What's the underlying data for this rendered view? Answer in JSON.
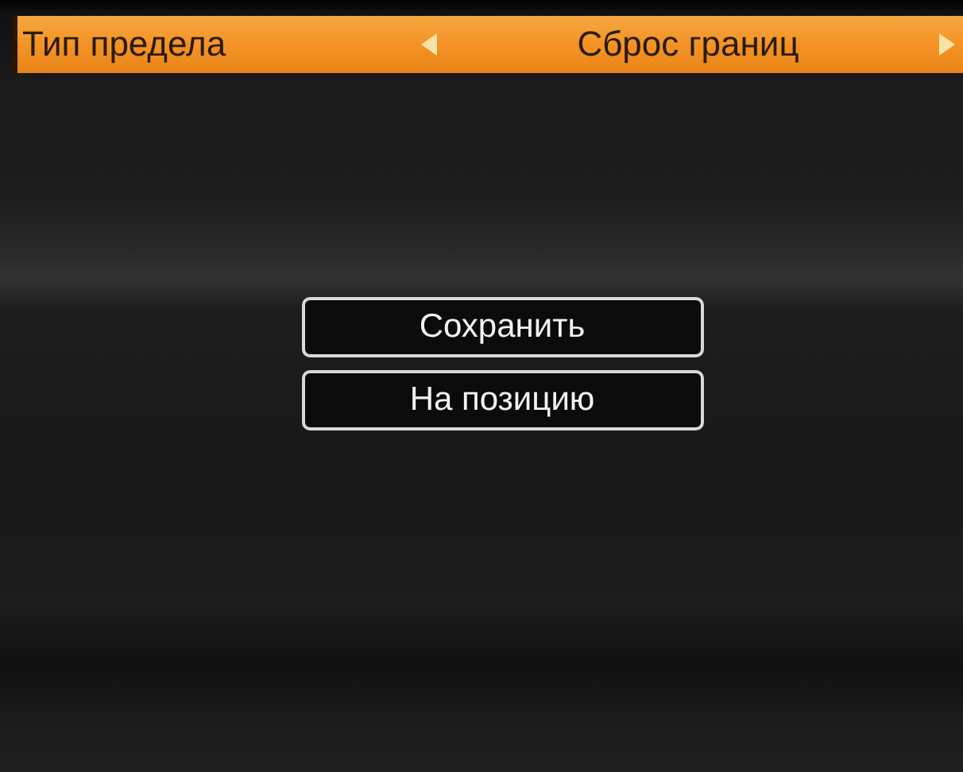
{
  "setting": {
    "label": "Тип предела",
    "value": "Сброс границ"
  },
  "buttons": [
    {
      "label": "Сохранить"
    },
    {
      "label": "На позицию"
    }
  ]
}
